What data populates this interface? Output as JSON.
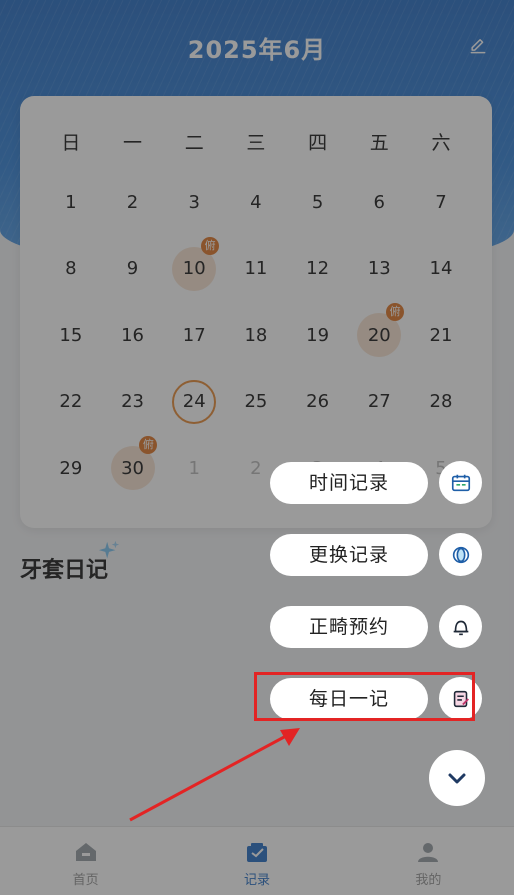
{
  "header": {
    "month_title": "2025年6月",
    "edit_icon": "pencil-icon"
  },
  "calendar": {
    "weekdays": [
      "日",
      "一",
      "二",
      "三",
      "四",
      "五",
      "六"
    ],
    "weeks": [
      [
        {
          "d": "1"
        },
        {
          "d": "2"
        },
        {
          "d": "3"
        },
        {
          "d": "4"
        },
        {
          "d": "5"
        },
        {
          "d": "6"
        },
        {
          "d": "7"
        }
      ],
      [
        {
          "d": "8"
        },
        {
          "d": "9"
        },
        {
          "d": "10",
          "marked": true,
          "badge": "俯"
        },
        {
          "d": "11"
        },
        {
          "d": "12"
        },
        {
          "d": "13"
        },
        {
          "d": "14"
        }
      ],
      [
        {
          "d": "15"
        },
        {
          "d": "16"
        },
        {
          "d": "17"
        },
        {
          "d": "18"
        },
        {
          "d": "19"
        },
        {
          "d": "20",
          "marked": true,
          "badge": "俯"
        },
        {
          "d": "21"
        }
      ],
      [
        {
          "d": "22"
        },
        {
          "d": "23"
        },
        {
          "d": "24",
          "today": true
        },
        {
          "d": "25"
        },
        {
          "d": "26"
        },
        {
          "d": "27"
        },
        {
          "d": "28"
        }
      ],
      [
        {
          "d": "29"
        },
        {
          "d": "30",
          "marked": true,
          "badge": "俯"
        },
        {
          "d": "1",
          "muted": true
        },
        {
          "d": "2",
          "muted": true
        },
        {
          "d": "3",
          "muted": true
        },
        {
          "d": "4",
          "muted": true
        },
        {
          "d": "5",
          "muted": true
        }
      ]
    ],
    "accent_color": "#e07b30"
  },
  "diary": {
    "title": "牙套日记"
  },
  "fab_menu": {
    "items": [
      {
        "label": "时间记录",
        "icon": "calendar-card-icon"
      },
      {
        "label": "更换记录",
        "icon": "retainer-icon"
      },
      {
        "label": "正畸预约",
        "icon": "bell-icon"
      },
      {
        "label": "每日一记",
        "icon": "notebook-edit-icon"
      }
    ],
    "close_icon": "chevron-down-icon",
    "highlighted_item": "每日一记"
  },
  "bottom_nav": {
    "items": [
      {
        "label": "首页",
        "icon": "home-icon"
      },
      {
        "label": "记录",
        "icon": "record-icon",
        "active": true
      },
      {
        "label": "我的",
        "icon": "profile-icon"
      }
    ]
  },
  "colors": {
    "brand_blue": "#2f73c6",
    "overlay": "rgba(40,40,40,0.47)",
    "annotation_red": "#e32424"
  }
}
